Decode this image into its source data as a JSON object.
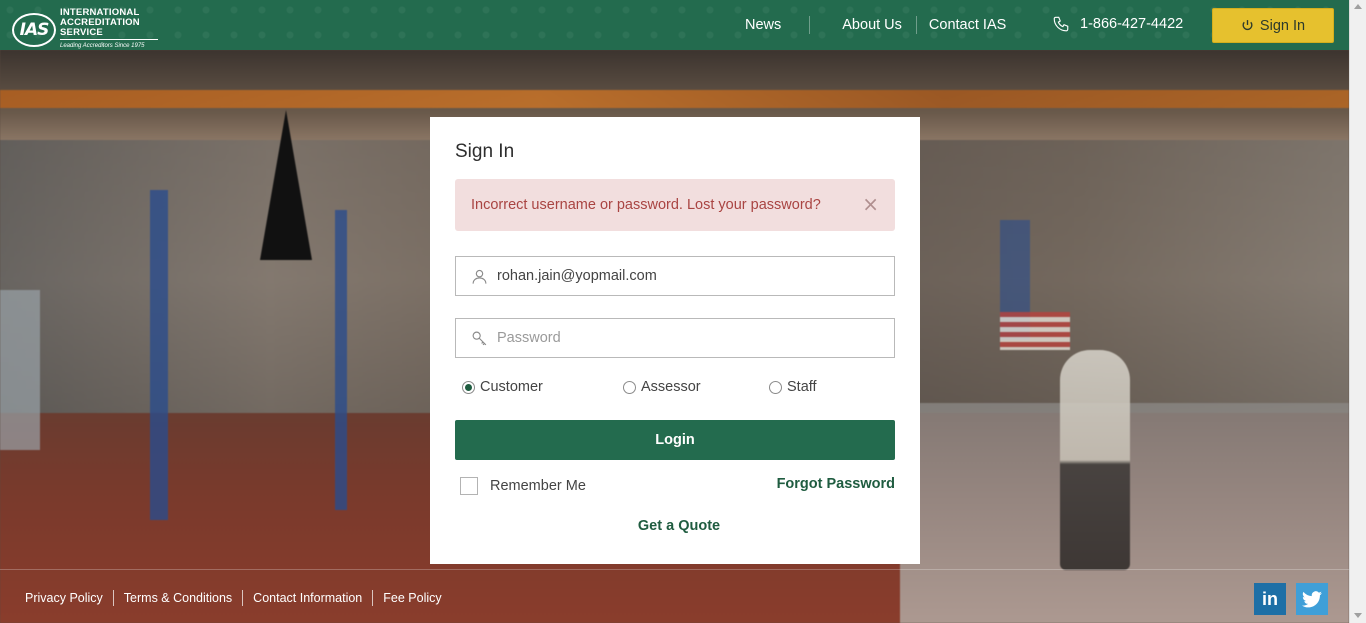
{
  "header": {
    "logo_title": "INTERNATIONAL ACCREDITATION SERVICE",
    "logo_mark": "IAS",
    "logo_tagline": "Leading Accreditors Since 1975",
    "nav": [
      "News",
      "About Us",
      "Contact IAS"
    ],
    "phone": "1-866-427-4422",
    "signin_label": "Sign In"
  },
  "form": {
    "title": "Sign In",
    "alert_text": "Incorrect username or password. Lost your password?",
    "alert_close": "×",
    "email_value": "rohan.jain@yopmail.com",
    "password_placeholder": "Password",
    "roles": [
      "Customer",
      "Assessor",
      "Staff"
    ],
    "selected_role": "Customer",
    "login_label": "Login",
    "remember_label": "Remember Me",
    "forgot_label": "Forgot Password",
    "quote_label": "Get a Quote"
  },
  "footer": {
    "links": [
      "Privacy Policy",
      "Terms & Conditions",
      "Contact Information",
      "Fee Policy"
    ],
    "social": [
      "linkedin-icon",
      "twitter-icon"
    ],
    "linkedin_text": "in"
  },
  "colors": {
    "brand_green": "#236b4e",
    "accent_yellow": "#e6c12e",
    "alert_bg": "#f2dede",
    "alert_text": "#a94442"
  }
}
